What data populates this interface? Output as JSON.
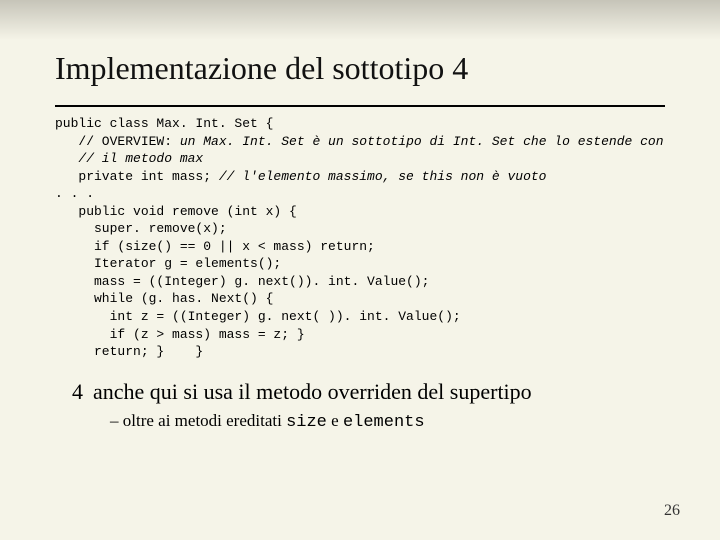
{
  "title": "Implementazione del sottotipo 4",
  "code": {
    "l1": "public class Max. Int. Set {",
    "l2a": "   // OVERVIEW:",
    "l2b": " un Max. Int. Set è un sottotipo di Int. Set che lo estende con",
    "l3": "   // il metodo max",
    "l4a": "   private int mass; ",
    "l4b": "// l'elemento massimo, se this non è vuoto",
    "l5": ". . .",
    "l6": "   public void remove (int x) {",
    "l7": "     super. remove(x);",
    "l8": "     if (size() == 0 || x < mass) return;",
    "l9": "     Iterator g = elements();",
    "l10": "     mass = ((Integer) g. next()). int. Value();",
    "l11": "     while (g. has. Next() {",
    "l12": "       int z = ((Integer) g. next( )). int. Value();",
    "l13": "       if (z > mass) mass = z; }",
    "l14": "     return; }    }"
  },
  "bullet": {
    "num": "4",
    "text": "anche qui si usa il metodo overriden del supertipo"
  },
  "subbullet": {
    "dash": "–",
    "t1": "oltre ai metodi ereditati ",
    "m1": "size",
    "t2": " e ",
    "m2": "elements"
  },
  "page": "26"
}
